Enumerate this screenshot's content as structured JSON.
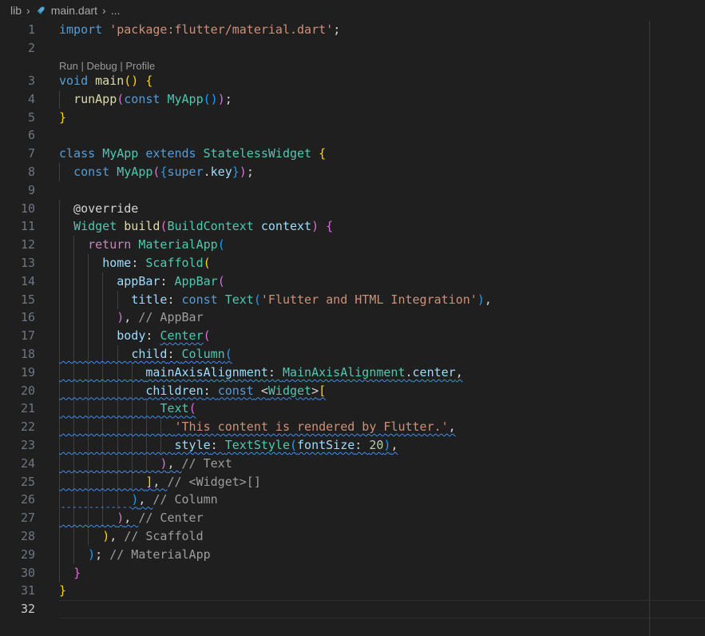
{
  "breadcrumb": {
    "folder": "lib",
    "file": "main.dart",
    "more": "..."
  },
  "codelens": "Run | Debug | Profile",
  "colors": {
    "background": "#1f1f1f",
    "keyword": "#569cd6",
    "type": "#4ec9b0",
    "string": "#ce9178",
    "comment": "#6a9955",
    "squiggle": "#3f8ef0"
  },
  "lines": [
    {
      "n": "1",
      "tokens": [
        [
          "kw",
          "import"
        ],
        [
          "pl",
          " "
        ],
        [
          "st",
          "'package:flutter/material.dart'"
        ],
        [
          "pl",
          ";"
        ]
      ]
    },
    {
      "n": "2",
      "tokens": []
    },
    {
      "n": "3",
      "tokens": [
        [
          "kw",
          "void"
        ],
        [
          "pl",
          " "
        ],
        [
          "fn",
          "main"
        ],
        [
          "b1",
          "()"
        ],
        [
          "pl",
          " "
        ],
        [
          "b1",
          "{"
        ]
      ]
    },
    {
      "n": "4",
      "tokens": [
        [
          "pl",
          "  "
        ],
        [
          "fn",
          "runApp"
        ],
        [
          "b2",
          "("
        ],
        [
          "kw",
          "const"
        ],
        [
          "pl",
          " "
        ],
        [
          "ty",
          "MyApp"
        ],
        [
          "b3",
          "()"
        ],
        [
          "b2",
          ")"
        ],
        [
          "pl",
          ";"
        ]
      ]
    },
    {
      "n": "5",
      "tokens": [
        [
          "b1",
          "}"
        ]
      ]
    },
    {
      "n": "6",
      "tokens": []
    },
    {
      "n": "7",
      "tokens": [
        [
          "kw",
          "class"
        ],
        [
          "pl",
          " "
        ],
        [
          "ty",
          "MyApp"
        ],
        [
          "pl",
          " "
        ],
        [
          "kw",
          "extends"
        ],
        [
          "pl",
          " "
        ],
        [
          "ty",
          "StatelessWidget"
        ],
        [
          "pl",
          " "
        ],
        [
          "b1",
          "{"
        ]
      ]
    },
    {
      "n": "8",
      "tokens": [
        [
          "pl",
          "  "
        ],
        [
          "kw",
          "const"
        ],
        [
          "pl",
          " "
        ],
        [
          "ty",
          "MyApp"
        ],
        [
          "b2",
          "("
        ],
        [
          "b3",
          "{"
        ],
        [
          "kw",
          "super"
        ],
        [
          "pl",
          "."
        ],
        [
          "pr",
          "key"
        ],
        [
          "b3",
          "}"
        ],
        [
          "b2",
          ")"
        ],
        [
          "pl",
          ";"
        ]
      ]
    },
    {
      "n": "9",
      "tokens": []
    },
    {
      "n": "10",
      "tokens": [
        [
          "pl",
          "  @override"
        ]
      ]
    },
    {
      "n": "11",
      "tokens": [
        [
          "pl",
          "  "
        ],
        [
          "ty",
          "Widget"
        ],
        [
          "pl",
          " "
        ],
        [
          "fn",
          "build"
        ],
        [
          "b2",
          "("
        ],
        [
          "ty",
          "BuildContext"
        ],
        [
          "pl",
          " "
        ],
        [
          "pr",
          "context"
        ],
        [
          "b2",
          ")"
        ],
        [
          "pl",
          " "
        ],
        [
          "b2",
          "{"
        ]
      ]
    },
    {
      "n": "12",
      "tokens": [
        [
          "pl",
          "    "
        ],
        [
          "ctl",
          "return"
        ],
        [
          "pl",
          " "
        ],
        [
          "ty",
          "MaterialApp"
        ],
        [
          "b3",
          "("
        ]
      ]
    },
    {
      "n": "13",
      "tokens": [
        [
          "pl",
          "      "
        ],
        [
          "pr",
          "home"
        ],
        [
          "pl",
          ": "
        ],
        [
          "ty",
          "Scaffold"
        ],
        [
          "b1",
          "("
        ]
      ]
    },
    {
      "n": "14",
      "tokens": [
        [
          "pl",
          "        "
        ],
        [
          "pr",
          "appBar"
        ],
        [
          "pl",
          ": "
        ],
        [
          "ty",
          "AppBar"
        ],
        [
          "b2",
          "("
        ]
      ]
    },
    {
      "n": "15",
      "tokens": [
        [
          "pl",
          "          "
        ],
        [
          "pr",
          "title"
        ],
        [
          "pl",
          ": "
        ],
        [
          "kw",
          "const"
        ],
        [
          "pl",
          " "
        ],
        [
          "ty",
          "Text"
        ],
        [
          "b3",
          "("
        ],
        [
          "st",
          "'Flutter and HTML Integration'"
        ],
        [
          "b3",
          ")"
        ],
        [
          "pl",
          ","
        ]
      ]
    },
    {
      "n": "16",
      "tokens": [
        [
          "pl",
          "        "
        ],
        [
          "b2",
          ")"
        ],
        [
          "pl",
          ", "
        ],
        [
          "cmg",
          "// AppBar"
        ]
      ]
    },
    {
      "n": "17",
      "tokens": [
        [
          "pl",
          "        "
        ],
        [
          "pr",
          "body"
        ],
        [
          "pl",
          ": "
        ],
        [
          "tysq",
          "Center"
        ],
        [
          "b2",
          "("
        ]
      ]
    },
    {
      "n": "18",
      "tokens": [
        [
          "pl",
          "          "
        ],
        [
          "pr",
          "child"
        ],
        [
          "pl",
          ": "
        ],
        [
          "ty",
          "Column"
        ],
        [
          "b3",
          "("
        ]
      ]
    },
    {
      "n": "19",
      "tokens": [
        [
          "pl",
          "            "
        ],
        [
          "pr",
          "mainAxisAlignment"
        ],
        [
          "pl",
          ": "
        ],
        [
          "ty",
          "MainAxisAlignment"
        ],
        [
          "pl",
          "."
        ],
        [
          "pr",
          "center"
        ],
        [
          "pl",
          ","
        ]
      ]
    },
    {
      "n": "20",
      "tokens": [
        [
          "pl",
          "            "
        ],
        [
          "pr",
          "children"
        ],
        [
          "pl",
          ": "
        ],
        [
          "kw",
          "const"
        ],
        [
          "pl",
          " <"
        ],
        [
          "ty",
          "Widget"
        ],
        [
          "pl",
          ">"
        ],
        [
          "b1",
          "["
        ]
      ]
    },
    {
      "n": "21",
      "tokens": [
        [
          "pl",
          "              "
        ],
        [
          "ty",
          "Text"
        ],
        [
          "b2",
          "("
        ]
      ]
    },
    {
      "n": "22",
      "tokens": [
        [
          "pl",
          "                "
        ],
        [
          "st",
          "'This content is rendered by Flutter.'"
        ],
        [
          "pl",
          ","
        ]
      ]
    },
    {
      "n": "23",
      "tokens": [
        [
          "pl",
          "                "
        ],
        [
          "pr",
          "style"
        ],
        [
          "pl",
          ": "
        ],
        [
          "ty",
          "TextStyle"
        ],
        [
          "b3",
          "("
        ],
        [
          "pr",
          "fontSize"
        ],
        [
          "pl",
          ": "
        ],
        [
          "nm",
          "20"
        ],
        [
          "b3",
          ")"
        ],
        [
          "pl",
          ","
        ]
      ]
    },
    {
      "n": "24",
      "tokens": [
        [
          "pl",
          "              "
        ],
        [
          "b2",
          ")"
        ],
        [
          "pl",
          ", "
        ],
        [
          "cmg",
          "// Text"
        ]
      ]
    },
    {
      "n": "25",
      "tokens": [
        [
          "pl",
          "            "
        ],
        [
          "b1",
          "]"
        ],
        [
          "pl",
          ", "
        ],
        [
          "cmg",
          "// <Widget>[]"
        ]
      ]
    },
    {
      "n": "26",
      "tokens": [
        [
          "pl",
          "          "
        ],
        [
          "b3",
          ")"
        ],
        [
          "pl",
          ", "
        ],
        [
          "cmg",
          "// Column"
        ]
      ]
    },
    {
      "n": "27",
      "tokens": [
        [
          "pl",
          "        "
        ],
        [
          "b2",
          ")"
        ],
        [
          "pl",
          ", "
        ],
        [
          "cmg",
          "// Center"
        ]
      ]
    },
    {
      "n": "28",
      "tokens": [
        [
          "pl",
          "      "
        ],
        [
          "b1",
          ")"
        ],
        [
          "pl",
          ", "
        ],
        [
          "cmg",
          "// Scaffold"
        ]
      ]
    },
    {
      "n": "29",
      "tokens": [
        [
          "pl",
          "    "
        ],
        [
          "b3",
          ")"
        ],
        [
          "pl",
          "; "
        ],
        [
          "cmg",
          "// MaterialApp"
        ]
      ]
    },
    {
      "n": "30",
      "tokens": [
        [
          "pl",
          "  "
        ],
        [
          "b2",
          "}"
        ]
      ]
    },
    {
      "n": "31",
      "tokens": [
        [
          "b1",
          "}"
        ]
      ]
    },
    {
      "n": "32",
      "tokens": []
    }
  ]
}
